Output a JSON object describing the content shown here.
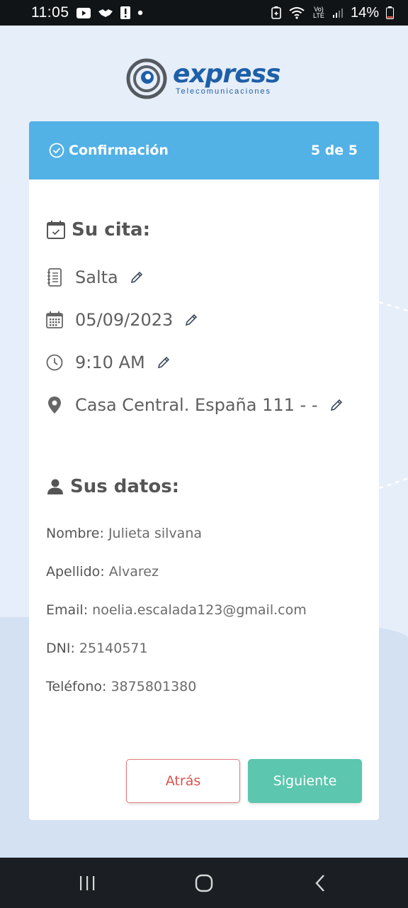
{
  "status_bar": {
    "time": "11:05",
    "network": "Vo) LTE",
    "battery_percent": "14%"
  },
  "logo": {
    "word": "express",
    "subtitle": "Telecomunicaciones"
  },
  "header": {
    "title": "Confirmación",
    "step": "5 de 5"
  },
  "appointment": {
    "title": "Su cita:",
    "location_city": "Salta",
    "date": "05/09/2023",
    "time": "9:10 AM",
    "office": "Casa Central. España 111 - -"
  },
  "personal": {
    "title": "Sus datos:",
    "rows": [
      {
        "label": "Nombre:",
        "value": "Julieta silvana"
      },
      {
        "label": "Apellido:",
        "value": "Alvarez"
      },
      {
        "label": "Email:",
        "value": "noelia.escalada123@gmail.com"
      },
      {
        "label": "DNI:",
        "value": "25140571"
      },
      {
        "label": "Teléfono:",
        "value": "3875801380"
      }
    ]
  },
  "buttons": {
    "back": "Atrás",
    "next": "Siguiente"
  },
  "colors": {
    "header_blue": "#52b1e5",
    "next_green": "#5cc6ae",
    "back_red": "#d9534f",
    "brand_blue": "#1e5fa8"
  }
}
